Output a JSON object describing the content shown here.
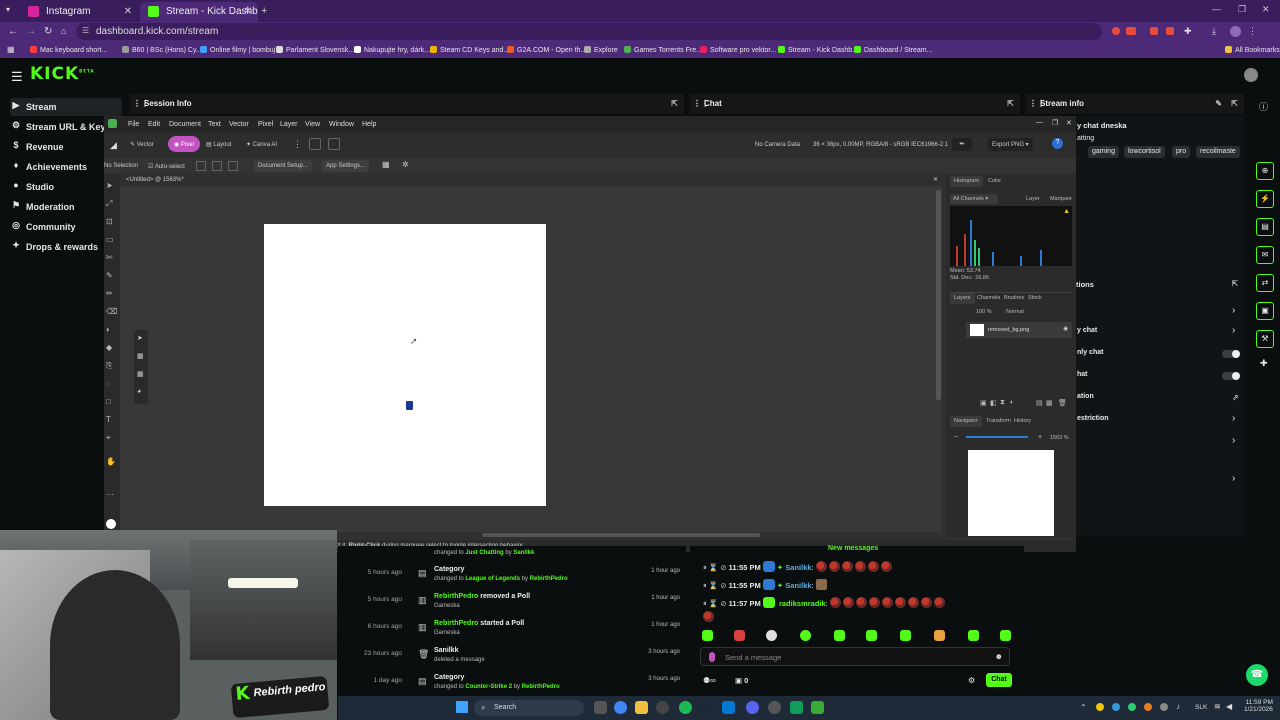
{
  "browser": {
    "tabs": [
      {
        "title": "Instagram",
        "color": "#d6249f"
      },
      {
        "title": "Stream - Kick Dashboard",
        "color": "#53fc18"
      }
    ],
    "new_tab": "+",
    "url": "dashboard.kick.com/stream",
    "bookmarks": [
      {
        "label": "Mac keyboard short...",
        "color": "#ff3c3c"
      },
      {
        "label": "B60 | BSc (Hons) Cy...",
        "color": "#999999"
      },
      {
        "label": "Online filmy | bombuj",
        "color": "#3da1ff"
      },
      {
        "label": "Parlament Slovensk...",
        "color": "#dddddd"
      },
      {
        "label": "Nakupujte hry, dárk...",
        "color": "#ffffff"
      },
      {
        "label": "Steam CD Keys and...",
        "color": "#f0b400"
      },
      {
        "label": "G2A.COM - Open th...",
        "color": "#f05a28"
      },
      {
        "label": "Explore",
        "color": "#aaaaaa"
      },
      {
        "label": "Games Torrents Fre...",
        "color": "#4caf50"
      },
      {
        "label": "Software pro vektor...",
        "color": "#e91e63"
      },
      {
        "label": "Stream - Kick Dashb...",
        "color": "#53fc18"
      },
      {
        "label": "Dashboard / Stream...",
        "color": "#53fc18"
      }
    ],
    "all_bookmarks": "All Bookmarks"
  },
  "kick": {
    "logo": "KICK",
    "logo_sup": "BETA",
    "sidebar": [
      {
        "label": "Stream",
        "icon": "stream-icon",
        "glyph": "▶"
      },
      {
        "label": "Stream URL & Key",
        "icon": "key-icon",
        "glyph": "⚙"
      },
      {
        "label": "Revenue",
        "icon": "revenue-icon",
        "glyph": "$"
      },
      {
        "label": "Achievements",
        "icon": "trophy-icon",
        "glyph": "♦"
      },
      {
        "label": "Studio",
        "icon": "studio-icon",
        "glyph": "●"
      },
      {
        "label": "Moderation",
        "icon": "moderation-icon",
        "glyph": "⚑"
      },
      {
        "label": "Community",
        "icon": "community-icon",
        "glyph": "◎"
      },
      {
        "label": "Drops & rewards",
        "icon": "gift-icon",
        "glyph": "✦"
      }
    ],
    "panels": {
      "session": "Session Info",
      "chat": "Chat",
      "stream_info": "Stream info"
    },
    "stream_info": {
      "title_fragment": "y chat dneska",
      "category_fragment": "atting",
      "tags": [
        "gaming",
        "lowcortisol",
        "pro",
        "recoilmaste"
      ],
      "actions_fragment": "tions",
      "settings": [
        {
          "label": "y chat",
          "control": "chevron"
        },
        {
          "label": "nly chat",
          "control": "toggle"
        },
        {
          "label": "hat",
          "control": "toggle"
        },
        {
          "label": "ation",
          "control": "external"
        },
        {
          "label": "estriction",
          "control": "chevron"
        },
        {
          "label": "",
          "control": "chevron"
        },
        {
          "label": "",
          "control": "chevron"
        }
      ]
    },
    "activity": [
      {
        "ago": "",
        "title": "",
        "sub_pre": "changed to ",
        "sub_a": "Just Chatting",
        "sub_mid": " by ",
        "sub_b": "Sanilkk",
        "time": ""
      },
      {
        "ago": "5 hours ago",
        "title": "Category",
        "sub_pre": "changed to ",
        "sub_a": "League of Legends",
        "sub_mid": " by ",
        "sub_b": "RebirthPedro",
        "time": "1 hour ago"
      },
      {
        "ago": "5 hours ago",
        "title_a": "RebirthPedro",
        "title": " removed a Poll",
        "sub_pre": "Gameska",
        "sub_a": "",
        "sub_mid": "",
        "sub_b": "",
        "time": "1 hour ago"
      },
      {
        "ago": "6 hours ago",
        "title_a": "RebirthPedro",
        "title": " started a Poll",
        "sub_pre": "Gameska",
        "sub_a": "",
        "sub_mid": "",
        "sub_b": "",
        "time": "1 hour ago"
      },
      {
        "ago": "23 hours ago",
        "title": "Sanilkk",
        "sub_pre": "deleted a message",
        "sub_a": "",
        "sub_mid": "",
        "sub_b": "",
        "time": "3 hours ago"
      },
      {
        "ago": "1 day ago",
        "title": "Category",
        "sub_pre": "changed to ",
        "sub_a": "Counter-Strike 2",
        "sub_mid": " by ",
        "sub_b": "RebirthPedro",
        "time": "3 hours ago"
      }
    ],
    "chat": {
      "new_messages": "New messages",
      "messages": [
        {
          "time": "11:55 PM",
          "user": "Sanilkk",
          "color": "#5dade2",
          "emotes": 6
        },
        {
          "time": "11:55 PM",
          "user": "Sanilkk",
          "color": "#5dade2",
          "emotes": 1
        },
        {
          "time": "11:57 PM",
          "user": "radiksmradik",
          "color": "#53fc18",
          "emotes": 10
        }
      ],
      "placeholder": "Send a message",
      "count": "0",
      "send": "Chat"
    }
  },
  "affinity": {
    "menu": [
      "File",
      "Edit",
      "Document",
      "Text",
      "Vector",
      "Pixel",
      "Layer",
      "View",
      "Window",
      "Help"
    ],
    "personas": [
      "Vector",
      "Pixel",
      "Layout",
      "Canva AI"
    ],
    "camera": "No Camera Data",
    "doc_info": "36 × 36px, 0.00MP, RGBA/8 - sRGB IEC61966-2.1",
    "export": "Export PNG",
    "no_selection": "No Selection",
    "auto_select": "Auto-select",
    "doc_setup": "Document Setup...",
    "app_settings": "App Settings...",
    "tab": "<Untitled> @ 1563%*",
    "histogram_tabs": [
      "Histogram",
      "Color"
    ],
    "channels": "All Channels",
    "layer_label": "Layer",
    "marquee_label": "Marquee",
    "mean": "Mean: 53.74",
    "stddev": "Std. Dev.: 26.86",
    "layers_tabs": [
      "Layers",
      "Channels",
      "Brushes",
      "Stock"
    ],
    "opacity": "100 %",
    "blend": "Normal",
    "layer_name": "removed_bg.png",
    "nav_tabs": [
      "Navigator",
      "Transform",
      "History"
    ],
    "zoom": "1563 %",
    "status": "Right-Click",
    "status_pre": "ct it. ",
    "status_post": " during marquee select to toggle intersection behavior."
  },
  "overlay": {
    "watermark": "Rebirth pedro"
  },
  "taskbar": {
    "search": "Search",
    "lang": "SLK",
    "time": "11:59 PM",
    "date": "1/21/2026"
  }
}
